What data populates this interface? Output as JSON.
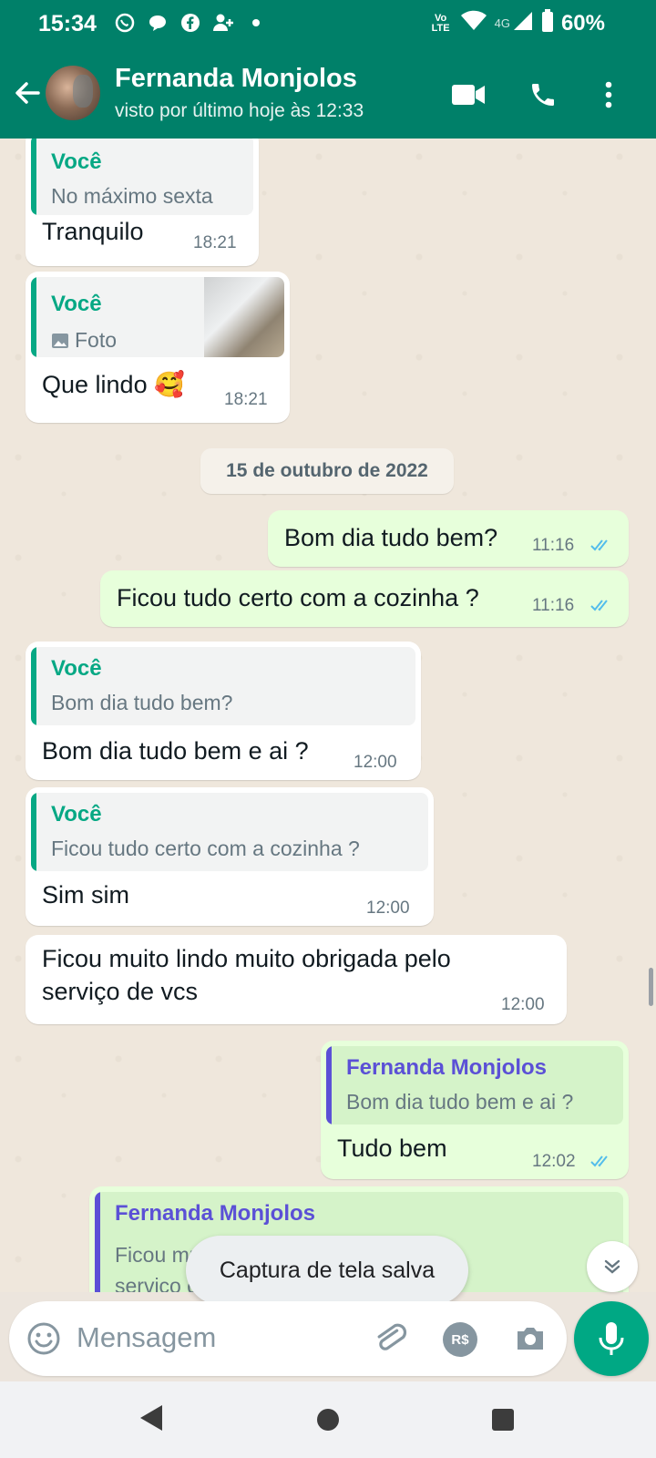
{
  "status_bar": {
    "time": "15:34",
    "battery": "60%",
    "network": "4G",
    "volte": "Vo LTE"
  },
  "header": {
    "contact_name": "Fernanda Monjolos",
    "last_seen": "visto por último hoje às 12:33"
  },
  "messages": [
    {
      "type": "in",
      "quote_author": "Você",
      "quote_text": "No máximo sexta",
      "text": "Tranquilo",
      "time": "18:21"
    },
    {
      "type": "in",
      "quote_author": "Você",
      "quote_text": "Foto",
      "text": "Que lindo 🥰",
      "time": "18:21"
    },
    {
      "type": "date",
      "text": "15 de outubro de 2022"
    },
    {
      "type": "out",
      "text": "Bom dia tudo bem?",
      "time": "11:16"
    },
    {
      "type": "out",
      "text": "Ficou tudo certo com a cozinha ?",
      "time": "11:16"
    },
    {
      "type": "in",
      "quote_author": "Você",
      "quote_text": "Bom dia tudo bem?",
      "text": "Bom dia tudo bem e ai ?",
      "time": "12:00"
    },
    {
      "type": "in",
      "quote_author": "Você",
      "quote_text": "Ficou tudo certo com a cozinha ?",
      "text": "Sim sim",
      "time": "12:00"
    },
    {
      "type": "in",
      "text_line1": "Ficou muito lindo muito obrigada pelo",
      "text_line2": "serviço de vcs",
      "time": "12:00"
    },
    {
      "type": "out",
      "quote_author": "Fernanda Monjolos",
      "quote_text": "Bom dia tudo bem e ai ?",
      "text": "Tudo bem",
      "time": "12:02"
    },
    {
      "type": "out",
      "quote_author": "Fernanda Monjolos",
      "quote_text_line1": "Ficou muito lindo muito obrigada pelo",
      "quote_text_line2": "serviço de vcs"
    }
  ],
  "toast": "Captura de tela salva",
  "input": {
    "placeholder": "Mensagem",
    "pay_label": "R$"
  },
  "colors": {
    "header": "#008069",
    "outgoing_bubble": "#e7ffdb",
    "incoming_bubble": "#ffffff",
    "quote_self": "#06a884",
    "quote_contact": "#5b50d6",
    "read_ticks": "#53bdeb",
    "mic_button": "#00a884"
  }
}
